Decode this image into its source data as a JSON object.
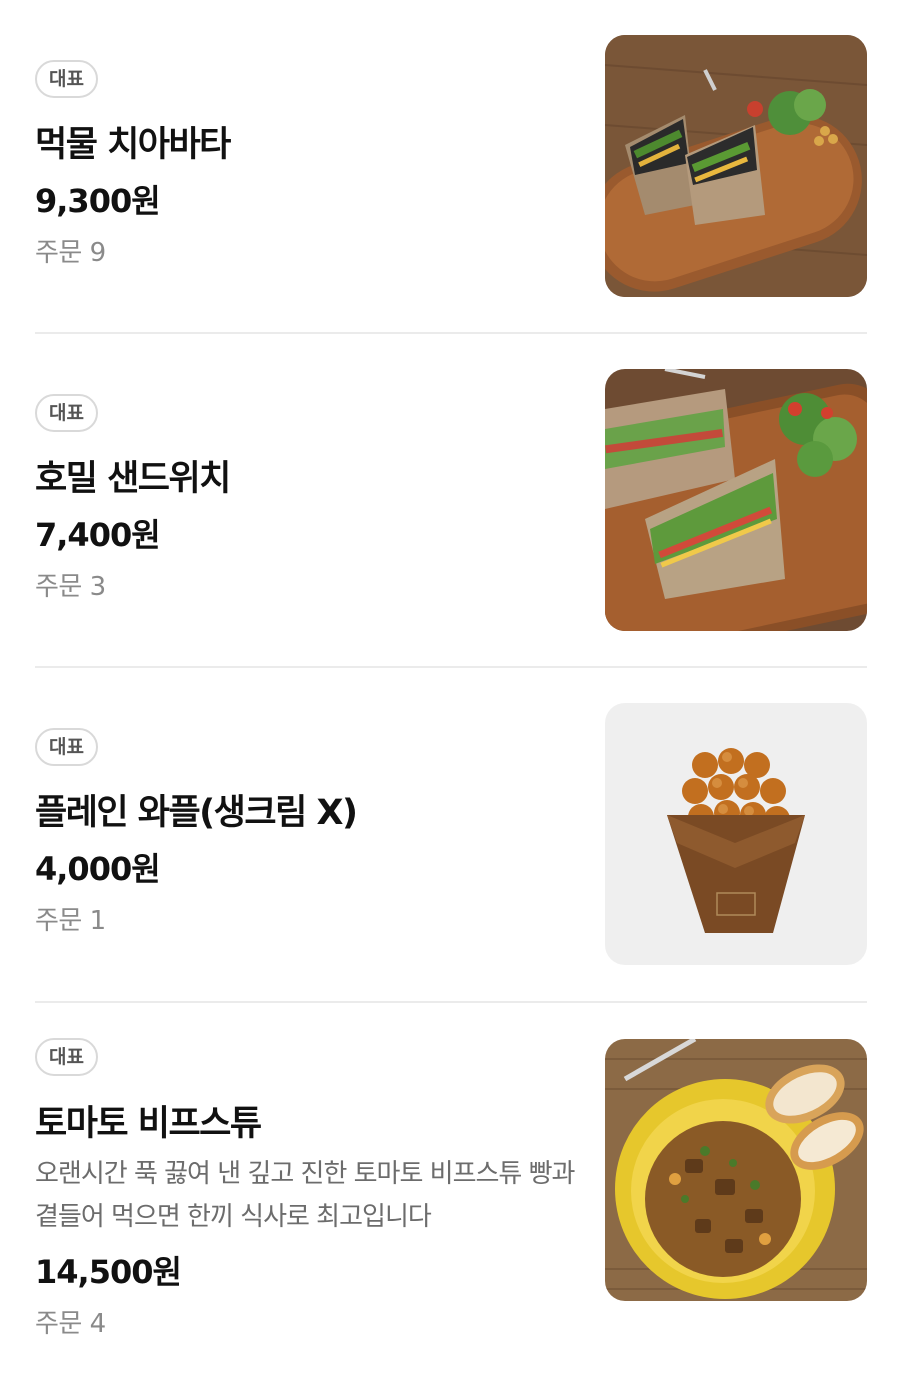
{
  "menu": {
    "items": [
      {
        "badge": "대표",
        "name": "먹물 치아바타",
        "price": "9,300원",
        "orders": "주문 9",
        "image": "squid-ink-ciabatta-sandwich-photo"
      },
      {
        "badge": "대표",
        "name": "호밀 샌드위치",
        "price": "7,400원",
        "orders": "주문 3",
        "image": "rye-sandwich-photo"
      },
      {
        "badge": "대표",
        "name": "플레인 와플(생크림 X)",
        "price": "4,000원",
        "orders": "주문 1",
        "image": "egg-waffle-cone-photo"
      },
      {
        "badge": "대표",
        "name": "토마토 비프스튜",
        "description": "오랜시간 푹 끓여 낸 깊고 진한 토마토 비프스튜 빵과 곁들어 먹으면 한끼 식사로 최고입니다",
        "price": "14,500원",
        "orders": "주문 4",
        "image": "tomato-beef-stew-photo"
      }
    ]
  },
  "colors": {
    "divider": "#ebebeb",
    "badge_border": "#d9d9d9",
    "secondary_text": "#8a8a8a",
    "primary_text": "#111111"
  }
}
